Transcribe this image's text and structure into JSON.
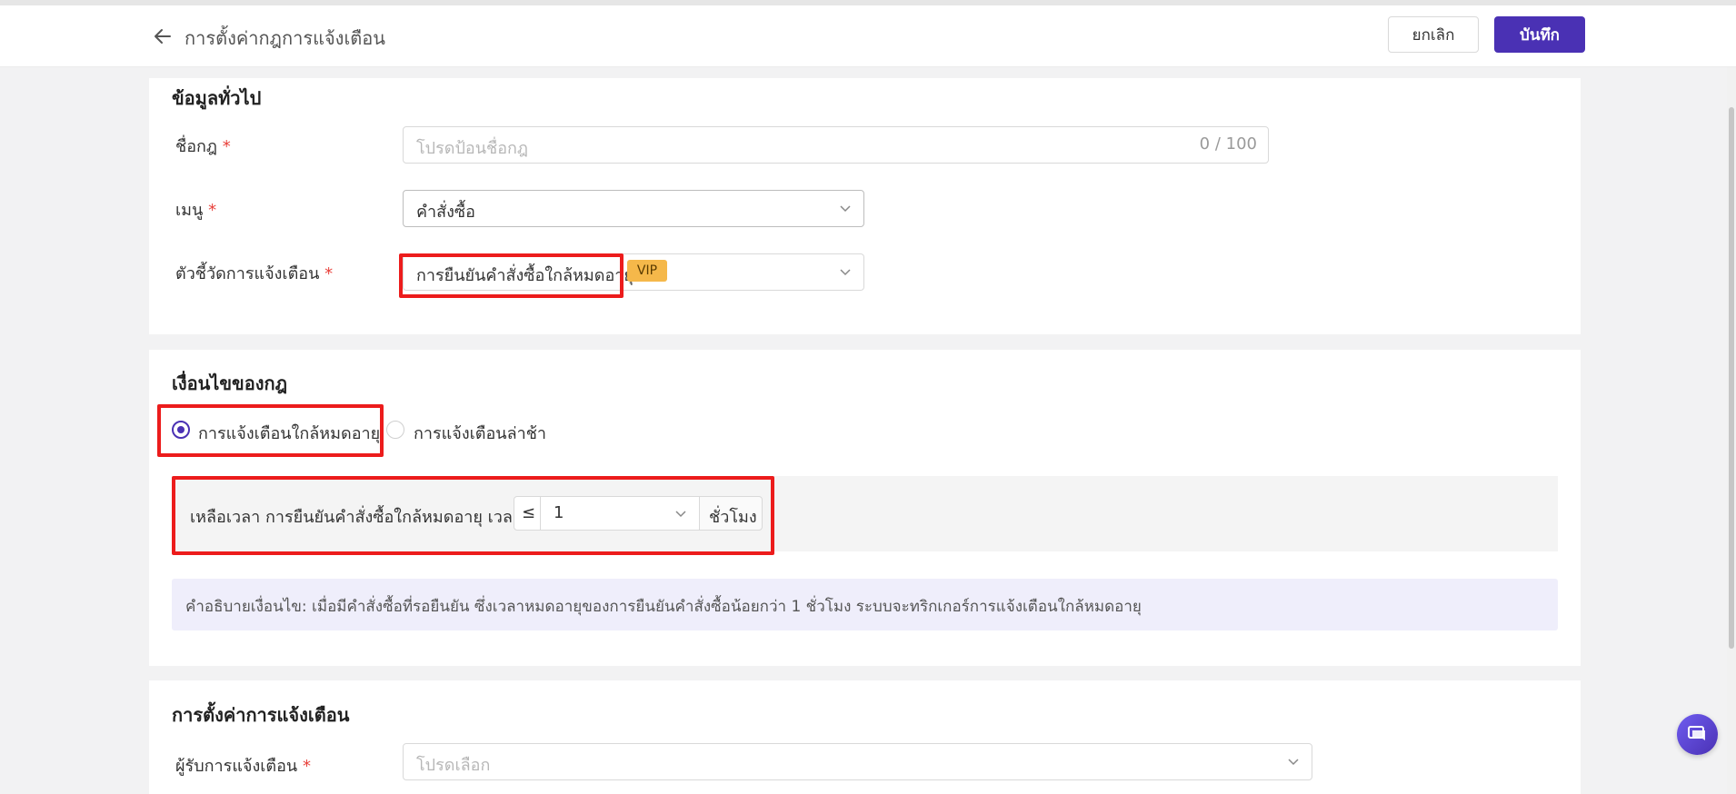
{
  "header": {
    "title": "การตั้งค่ากฎการแจ้งเตือน",
    "cancel_label": "ยกเลิก",
    "save_label": "บันทึก"
  },
  "general": {
    "section_title": "ข้อมูลทั่วไป",
    "rule_name_label": "ชื่อกฎ",
    "rule_name_placeholder": "โปรดป้อนชื่อกฎ",
    "rule_name_counter": "0 / 100",
    "menu_label": "เมนู",
    "menu_value": "คำสั่งซื้อ",
    "metric_label": "ตัวชี้วัดการแจ้งเตือน",
    "metric_value": "การยืนยันคำสั่งซื้อใกล้หมดอายุ",
    "metric_badge": "VIP",
    "required_mark": "*"
  },
  "conditions": {
    "section_title": "เงื่อนไขของกฎ",
    "options": [
      {
        "label": "การแจ้งเตือนใกล้หมดอายุ",
        "selected": true
      },
      {
        "label": "การแจ้งเตือนล่าช้า",
        "selected": false
      }
    ],
    "condition_text": "เหลือเวลา การยืนยันคำสั่งซื้อใกล้หมดอายุ เวลา",
    "operator": "≤",
    "amount": "1",
    "unit": "ชั่วโมง",
    "description": "คำอธิบายเงื่อนไข: เมื่อมีคำสั่งซื้อที่รอยืนยัน ซึ่งเวลาหมดอายุของการยืนยันคำสั่งซื้อน้อยกว่า 1 ชั่วโมง ระบบจะทริกเกอร์การแจ้งเตือนใกล้หมดอายุ"
  },
  "notification": {
    "section_title": "การตั้งค่าการแจ้งเตือน",
    "recipient_label": "ผู้รับการแจ้งเตือน",
    "recipient_placeholder": "โปรดเลือก"
  },
  "colors": {
    "primary": "#4a31b4",
    "required": "#e8413b",
    "highlight": "#ec1c1c",
    "vip": "#f5b84a"
  }
}
